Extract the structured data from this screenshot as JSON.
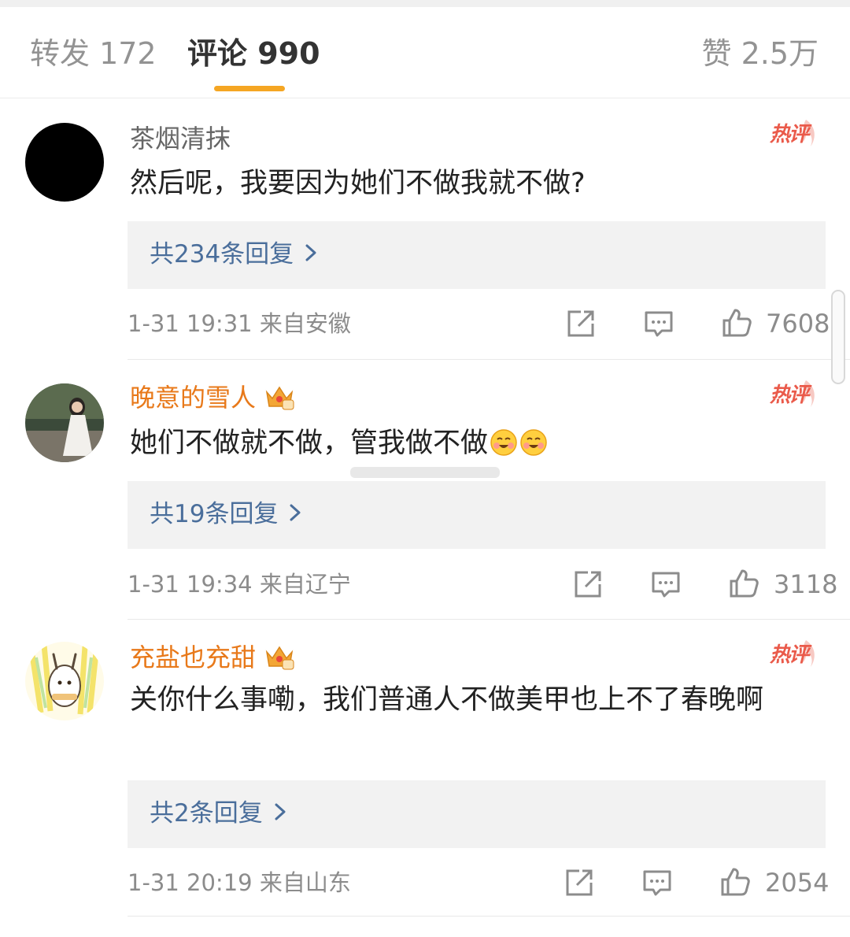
{
  "tabs": {
    "repost": "转发 172",
    "comments": "评论 990",
    "likes": "赞 2.5万"
  },
  "hot_label": "热评",
  "comments": [
    {
      "username": "茶烟清抹",
      "text": "然后呢，我要因为她们不做我就不做?",
      "replies": "共234条回复",
      "time": "1-31 19:31",
      "location": "来自安徽",
      "likes": "7608"
    },
    {
      "username": "晚意的雪人",
      "text": "她们不做就不做，管我做不做",
      "replies": "共19条回复",
      "time": "1-31 19:34",
      "location": "来自辽宁",
      "likes": "3118"
    },
    {
      "username": "充盐也充甜",
      "text": "关你什么事嘞，我们普通人不做美甲也上不了春晚啊",
      "replies": "共2条回复",
      "time": "1-31 20:19",
      "location": "来自山东",
      "likes": "2054"
    }
  ],
  "colors": {
    "accent": "#f5a623",
    "vip_name": "#e8791a",
    "hot_red": "#ea5a4a",
    "reply_link": "#4a6e9b"
  },
  "icons": [
    "share-icon",
    "comment-icon",
    "like-icon",
    "vip-crown-icon",
    "smile-emoji-icon",
    "chevron-right-icon"
  ]
}
